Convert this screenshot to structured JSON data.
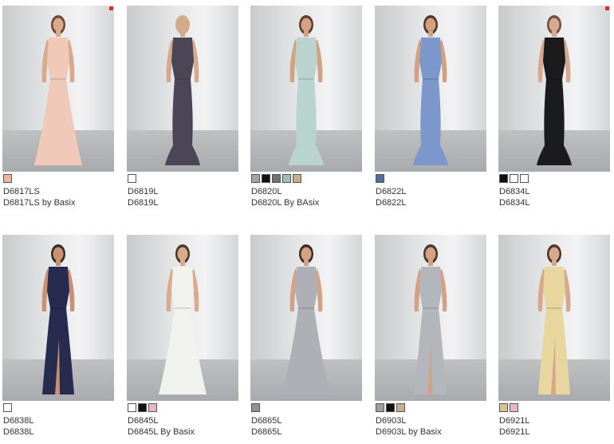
{
  "products": [
    {
      "code": "D6817LS",
      "title": "D6817LS by Basix",
      "dress": "#f0c9b8",
      "skin": "#d9a98e",
      "hair": "#6a4a35",
      "new": true,
      "style": "gown",
      "swatches": [
        "#e9b7a2"
      ]
    },
    {
      "code": "D6819L",
      "title": "D6819L",
      "dress": "#4a4656",
      "skin": "#d6a88e",
      "hair": "#c9b086",
      "new": false,
      "style": "mermaid",
      "swatches": [
        "#ffffff"
      ]
    },
    {
      "code": "D6820L",
      "title": "D6820L By BAsix",
      "dress": "#b9d4cf",
      "skin": "#d3a283",
      "hair": "#5b3f2e",
      "new": false,
      "style": "mermaid",
      "swatches": [
        "#9aa7ad",
        "#111111",
        "#6b7377",
        "#9cc3b2",
        "#c8ad92"
      ]
    },
    {
      "code": "D6822L",
      "title": "D6822L",
      "dress": "#7b97cc",
      "skin": "#d2a184",
      "hair": "#4e3728",
      "new": false,
      "style": "mermaid",
      "swatches": [
        "#4e6f9d"
      ]
    },
    {
      "code": "D6834L",
      "title": "D6834L",
      "dress": "#1b1b1d",
      "skin": "#d8a98e",
      "hair": "#6b5140",
      "new": true,
      "style": "mermaid",
      "swatches": [
        "#111111",
        "#ffffff",
        "#ffffff"
      ]
    },
    {
      "code": "D6838L",
      "title": "D6838L",
      "dress": "#272b4f",
      "skin": "#c99174",
      "hair": "#3a2a20",
      "new": false,
      "style": "slit",
      "swatches": [
        "#ffffff"
      ]
    },
    {
      "code": "D6845L",
      "title": "D6845L By Basix",
      "dress": "#f1f1ee",
      "skin": "#d8aa8e",
      "hair": "#4d3627",
      "new": false,
      "style": "gown",
      "swatches": [
        "#ffffff",
        "#111111",
        "#e7b8bf"
      ]
    },
    {
      "code": "D6865L",
      "title": "D6865L",
      "dress": "#aeb0b6",
      "skin": "#d3a285",
      "hair": "#3f2c21",
      "new": false,
      "style": "gown",
      "swatches": [
        "#8e9196"
      ]
    },
    {
      "code": "D6903L",
      "title": "D6903L by Basix",
      "dress": "#b3b6bb",
      "skin": "#d3a286",
      "hair": "#4a3425",
      "new": false,
      "style": "slit",
      "swatches": [
        "#9a9ea3",
        "#111111",
        "#c8ad92"
      ]
    },
    {
      "code": "D6921L",
      "title": "D6921L",
      "dress": "#e7d79e",
      "skin": "#d6a78a",
      "hair": "#4b3526",
      "new": false,
      "style": "slit",
      "swatches": [
        "#d8c29a",
        "#e7b8bf"
      ]
    }
  ]
}
